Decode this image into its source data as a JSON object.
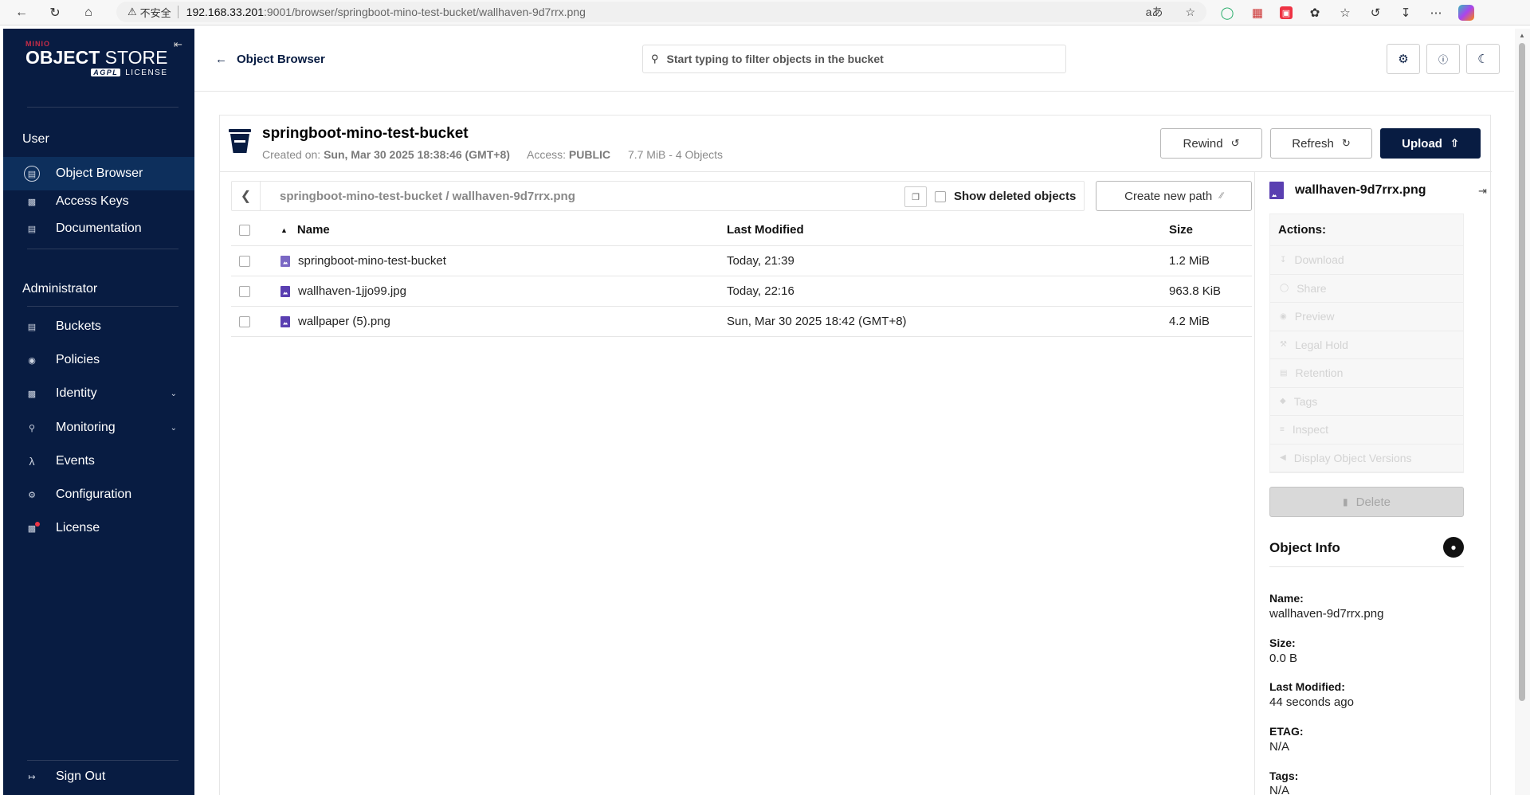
{
  "browser": {
    "warning_label": "不安全",
    "url_host": "192.168.33.201",
    "url_path": ":9001/browser/springboot-mino-test-bucket/wallhaven-9d7rrx.png",
    "read_aloud_label": "aあ"
  },
  "sidebar": {
    "brand_minio": "MINIO",
    "brand_object": "OBJECT",
    "brand_store": " STORE",
    "brand_agpl": "AGPL",
    "brand_license": "LICENSE",
    "user_section": "User",
    "admin_section": "Administrator",
    "items": {
      "object_browser": "Object Browser",
      "access_keys": "Access Keys",
      "documentation": "Documentation",
      "buckets": "Buckets",
      "policies": "Policies",
      "identity": "Identity",
      "monitoring": "Monitoring",
      "events": "Events",
      "configuration": "Configuration",
      "license": "License",
      "sign_out": "Sign Out"
    }
  },
  "header": {
    "back_label": "Object Browser",
    "search_placeholder": "Start typing to filter objects in the bucket"
  },
  "bucket": {
    "name": "springboot-mino-test-bucket",
    "created_label": "Created on:",
    "created_value": "Sun, Mar 30 2025 18:38:46 (GMT+8)",
    "access_label": "Access:",
    "access_value": "PUBLIC",
    "usage": "7.7 MiB - 4 Objects",
    "rewind_label": "Rewind",
    "refresh_label": "Refresh",
    "upload_label": "Upload"
  },
  "breadcrumb": {
    "path": "springboot-mino-test-bucket / wallhaven-9d7rrx.png",
    "show_deleted_label": "Show deleted objects",
    "create_path_label": "Create new path"
  },
  "table": {
    "columns": {
      "name": "Name",
      "modified": "Last Modified",
      "size": "Size"
    },
    "rows": [
      {
        "name": "springboot-mino-test-bucket",
        "modified": "Today, 21:39",
        "size": "1.2 MiB"
      },
      {
        "name": "wallhaven-1jjo99.jpg",
        "modified": "Today, 22:16",
        "size": "963.8 KiB"
      },
      {
        "name": "wallpaper (5).png",
        "modified": "Sun, Mar 30 2025 18:42 (GMT+8)",
        "size": "4.2 MiB"
      }
    ]
  },
  "details": {
    "file_name": "wallhaven-9d7rrx.png",
    "actions_title": "Actions:",
    "actions": {
      "download": "Download",
      "share": "Share",
      "preview": "Preview",
      "legal_hold": "Legal Hold",
      "retention": "Retention",
      "tags": "Tags",
      "inspect": "Inspect",
      "versions": "Display Object Versions"
    },
    "delete_label": "Delete",
    "info_title": "Object Info",
    "info": {
      "name_label": "Name:",
      "name_value": "wallhaven-9d7rrx.png",
      "size_label": "Size:",
      "size_value": "0.0 B",
      "modified_label": "Last Modified:",
      "modified_value": "44 seconds ago",
      "etag_label": "ETAG:",
      "etag_value": "N/A",
      "tags_label": "Tags:",
      "tags_value": "N/A"
    }
  },
  "colors": {
    "sidebar_bg": "#081c42",
    "active_item_bg": "#0d2f5c",
    "primary_button": "#081c42",
    "file_icon": "#5a3fb1"
  }
}
